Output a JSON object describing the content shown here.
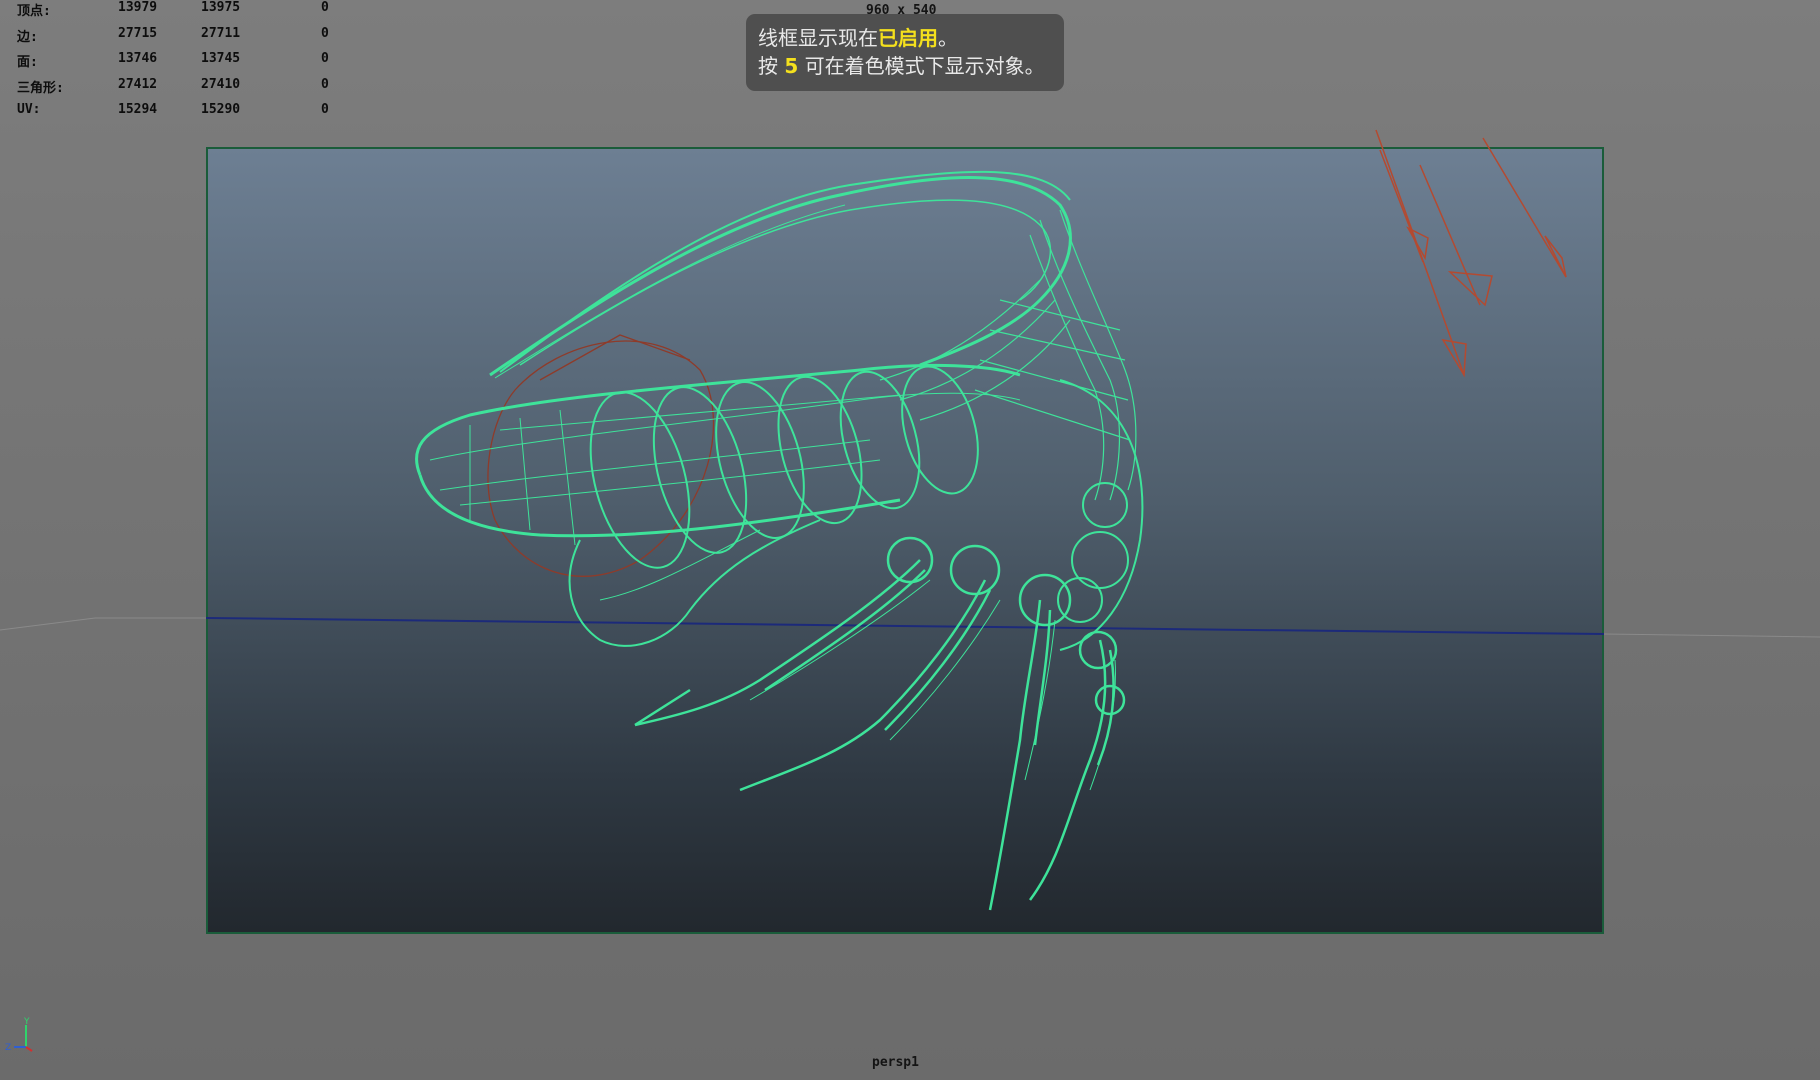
{
  "stats": {
    "rows": [
      {
        "label": "顶点:",
        "v1": "13979",
        "v2": "13975",
        "v3": "0"
      },
      {
        "label": "边:",
        "v1": "27715",
        "v2": "27711",
        "v3": "0"
      },
      {
        "label": "面:",
        "v1": "13746",
        "v2": "13745",
        "v3": "0"
      },
      {
        "label": "三角形:",
        "v1": "27412",
        "v2": "27410",
        "v3": "0"
      },
      {
        "label": "UV:",
        "v1": "15294",
        "v2": "15290",
        "v3": "0"
      }
    ]
  },
  "viewport": {
    "resolution_label": "960 x 540",
    "camera_name": "persp1"
  },
  "notification": {
    "line1_prefix": "线框显示现在",
    "line1_highlight": "已启用",
    "line1_suffix": "。",
    "line2_prefix": "按",
    "line2_key": "5",
    "line2_suffix": "可在着色模式下显示对象。"
  },
  "gizmo": {
    "y": "Y",
    "z": "Z"
  },
  "colors": {
    "wireframe": "#3ee39a",
    "background": "#747474",
    "camera_gradient_top": "#6d7f93",
    "camera_gradient_bottom": "#22282e",
    "horizon_line": "#1c2a7a",
    "light_arrows": "#b44a30",
    "highlight": "#f4e01d"
  },
  "icons": [
    "axis-gizmo-icon",
    "directional-light-icon",
    "camera-frame-icon"
  ]
}
